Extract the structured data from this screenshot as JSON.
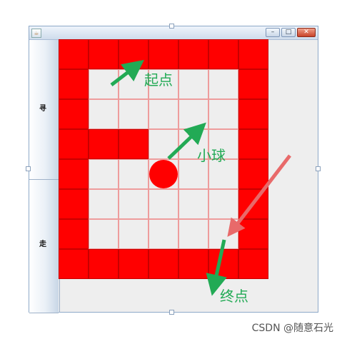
{
  "window": {
    "title": "",
    "minimize_label": "–",
    "restore_label": "□",
    "close_label": "✕",
    "app_icon": "java-cup-icon"
  },
  "buttons": {
    "find_label": "寻",
    "walk_label": "走"
  },
  "maze": {
    "cols": 7,
    "rows": 8,
    "cells": [
      "WWWWWWW",
      "W.....W",
      "W.....W",
      "WWW...W",
      "W.....W",
      "W.....W",
      "W.....W",
      "WWWWWWW"
    ],
    "ball_cell": [
      3,
      4
    ],
    "colors": {
      "wall": "#ff0000",
      "floor": "#eeeeee",
      "grid": "#ee9c9c"
    }
  },
  "annotations": {
    "start_label": "起点",
    "ball_label": "小球",
    "end_label": "终点",
    "arrow_color": "#22aa55",
    "pointer_color": "#f07070"
  },
  "watermark": "CSDN @随意石光"
}
